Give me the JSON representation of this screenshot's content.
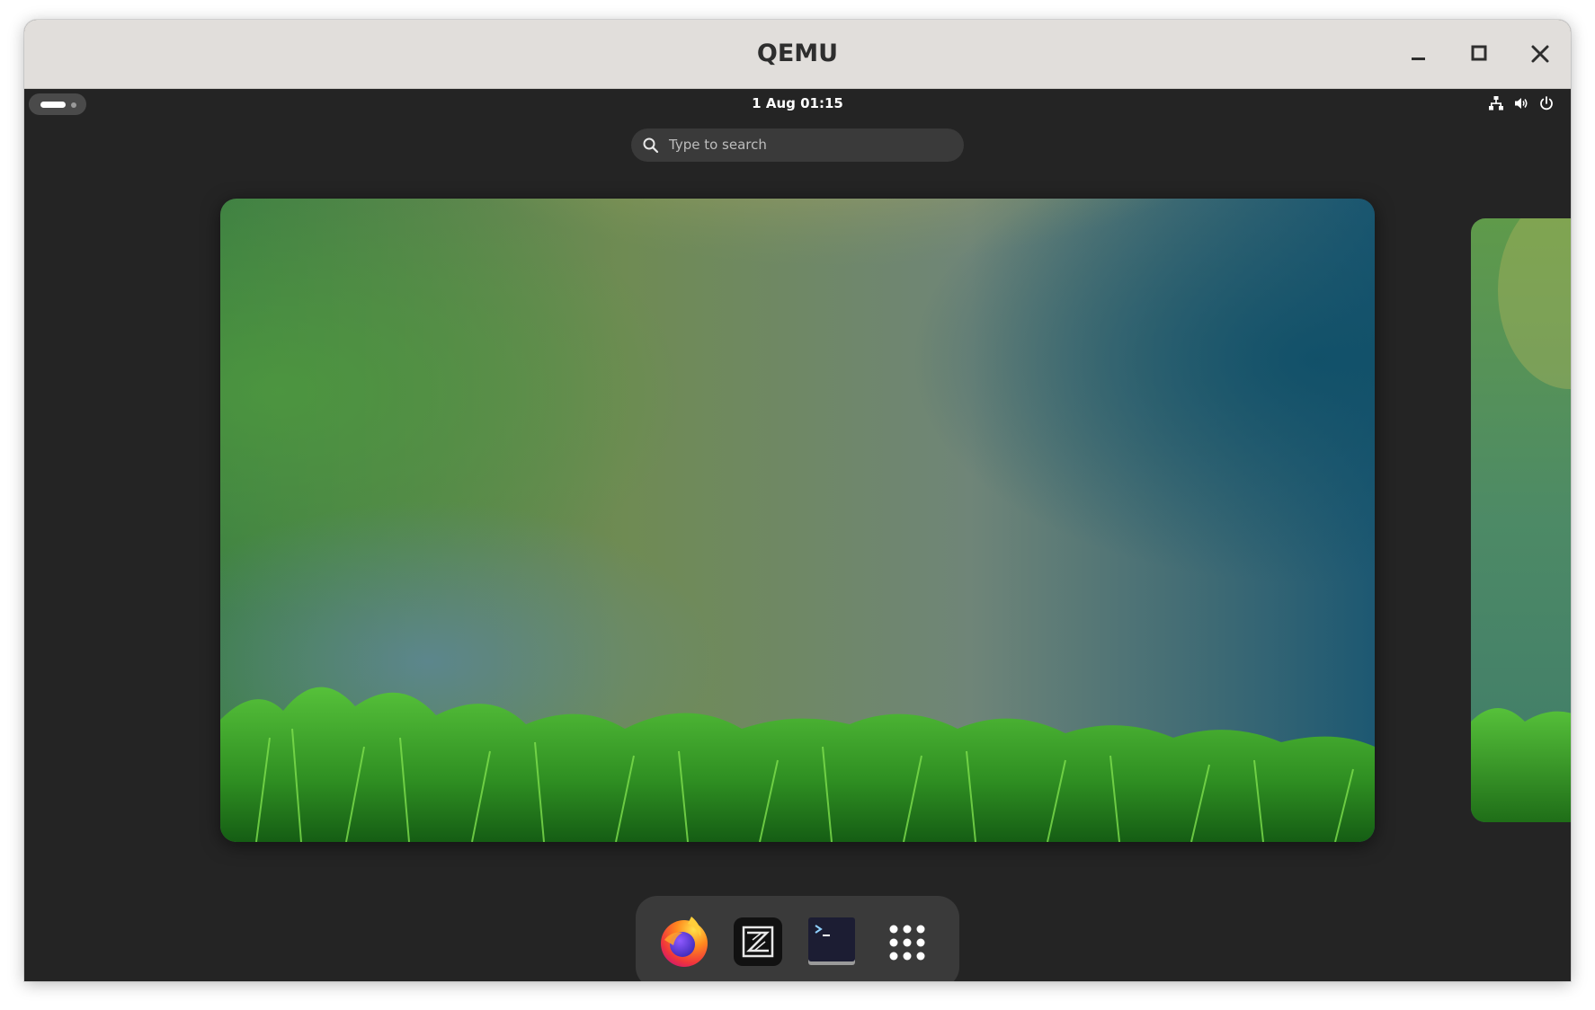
{
  "window": {
    "title": "QEMU",
    "controls": [
      "minimize",
      "maximize",
      "close"
    ]
  },
  "topbar": {
    "activities_label": "Activities",
    "clock": "1 Aug  01:15",
    "tray": [
      "network-icon",
      "volume-icon",
      "power-icon"
    ]
  },
  "search": {
    "placeholder": "Type to search"
  },
  "dash": {
    "apps": [
      {
        "name": "Firefox",
        "icon": "firefox-icon"
      },
      {
        "name": "Zed",
        "icon": "zed-icon"
      },
      {
        "name": "Terminal",
        "icon": "terminal-icon"
      },
      {
        "name": "Show Apps",
        "icon": "app-grid-icon"
      }
    ]
  },
  "colors": {
    "titlebar": "#e1dedb",
    "shell_bg": "#242424",
    "dash_bg": "#3a3a3a",
    "search_bg": "#3a3a3a"
  }
}
